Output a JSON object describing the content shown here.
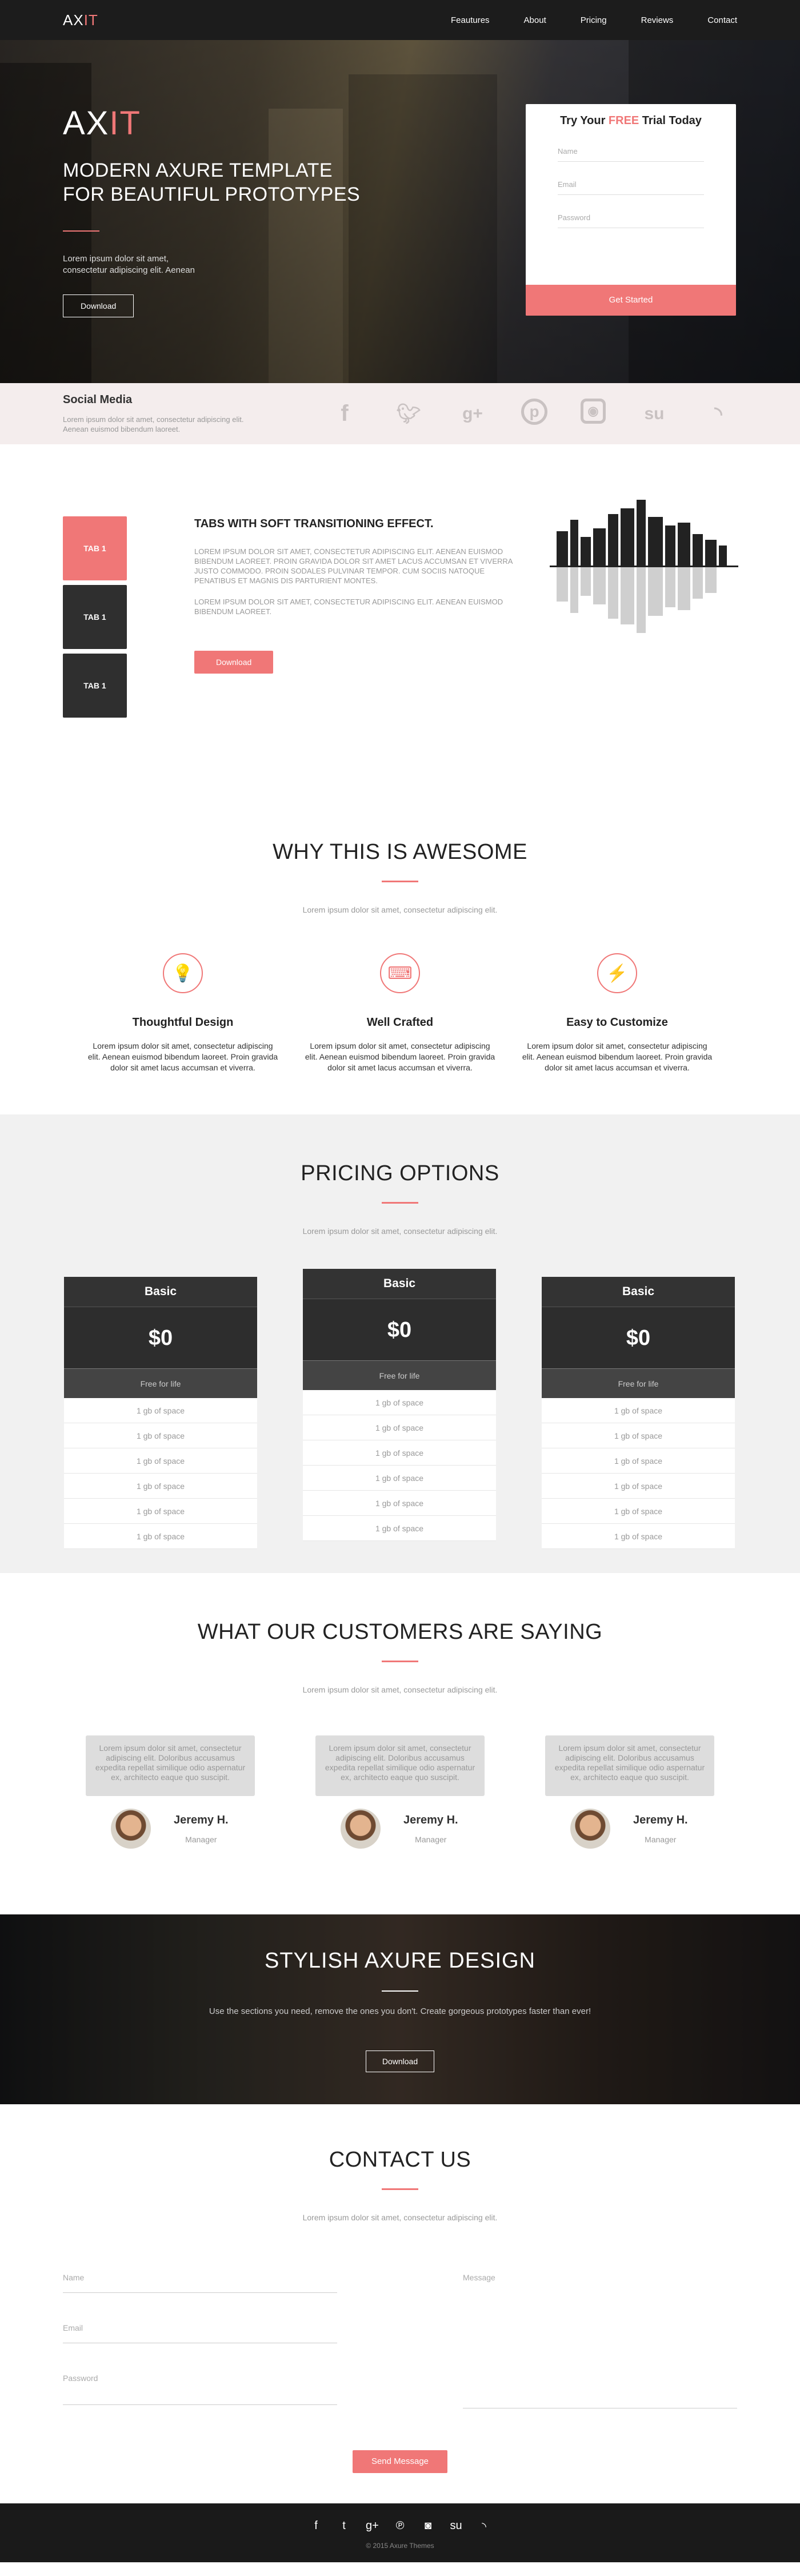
{
  "nav": {
    "logo_a": "AX",
    "logo_b": "IT",
    "links": [
      "Feautures",
      "About",
      "Pricing",
      "Reviews",
      "Contact"
    ]
  },
  "hero": {
    "logo_a": "AX",
    "logo_b": "IT",
    "title_line1": "MODERN AXURE TEMPLATE",
    "title_line2": "FOR BEAUTIFUL PROTOTYPES",
    "text_line1": "Lorem ipsum dolor sit amet,",
    "text_line2": "consectetur adipiscing elit. Aenean",
    "button": "Download"
  },
  "trial": {
    "title_a": "Try Your ",
    "title_free": "FREE",
    "title_b": " Trial Today",
    "name_placeholder": "Name",
    "email_placeholder": "Email",
    "password_placeholder": "Password",
    "button": "Get Started"
  },
  "social": {
    "title": "Social Media",
    "text": "Lorem ipsum dolor sit amet, consectetur adipiscing elit. Aenean euismod bibendum laoreet.",
    "icons": [
      "f",
      "t",
      "g+",
      "p",
      "ig",
      "su",
      "rss"
    ]
  },
  "tabs": {
    "labels": [
      "TAB 1",
      "TAB 1",
      "TAB 1"
    ],
    "heading": "TABS WITH SOFT TRANSITIONING EFFECT.",
    "para1": "LOREM IPSUM DOLOR SIT AMET, CONSECTETUR ADIPISCING ELIT. AENEAN EUISMOD BIBENDUM LAOREET. PROIN GRAVIDA DOLOR SIT AMET LACUS ACCUMSAN ET VIVERRA JUSTO COMMODO. PROIN SODALES PULVINAR TEMPOR. CUM SOCIIS NATOQUE PENATIBUS ET MAGNIS DIS PARTURIENT MONTES.",
    "para2": "LOREM IPSUM DOLOR SIT AMET, CONSECTETUR ADIPISCING ELIT. AENEAN EUISMOD BIBENDUM LAOREET.",
    "button": "Download"
  },
  "why": {
    "title": "WHY THIS IS AWESOME",
    "subtitle": "Lorem ipsum dolor sit amet, consectetur adipiscing elit.",
    "features": [
      {
        "icon": "lightbulb-icon",
        "glyph": "💡",
        "title": "Thoughtful Design",
        "text": "Lorem ipsum dolor sit amet, consectetur adipiscing elit. Aenean euismod bibendum laoreet. Proin gravida  dolor sit amet lacus accumsan et viverra."
      },
      {
        "icon": "keyboard-icon",
        "glyph": "⌨",
        "title": "Well Crafted",
        "text": "Lorem ipsum dolor sit amet, consectetur adipiscing elit. Aenean euismod bibendum laoreet. Proin gravida  dolor sit amet lacus accumsan et viverra."
      },
      {
        "icon": "bolt-icon",
        "glyph": "⚡",
        "title": "Easy to Customize",
        "text": "Lorem ipsum dolor sit amet, consectetur adipiscing elit. Aenean euismod bibendum laoreet. Proin gravida  dolor sit amet lacus accumsan et viverra."
      }
    ]
  },
  "pricing": {
    "title": "PRICING OPTIONS",
    "subtitle": "Lorem ipsum dolor sit amet, consectetur adipiscing elit.",
    "plans": [
      {
        "name": "Basic",
        "price": "$0",
        "note": "Free for life",
        "features": [
          "1 gb of space",
          "1 gb of space",
          "1 gb of space",
          "1 gb of space",
          "1 gb of space",
          "1 gb of space"
        ]
      },
      {
        "name": "Basic",
        "price": "$0",
        "note": "Free for life",
        "features": [
          "1 gb of space",
          "1 gb of space",
          "1 gb of space",
          "1 gb of space",
          "1 gb of space",
          "1 gb of space"
        ]
      },
      {
        "name": "Basic",
        "price": "$0",
        "note": "Free for life",
        "features": [
          "1 gb of space",
          "1 gb of space",
          "1 gb of space",
          "1 gb of space",
          "1 gb of space",
          "1 gb of space"
        ]
      }
    ]
  },
  "testimonials": {
    "title": "WHAT OUR CUSTOMERS ARE SAYING",
    "subtitle": "Lorem ipsum dolor sit amet, consectetur adipiscing elit.",
    "items": [
      {
        "quote": "Lorem ipsum dolor sit amet, consectetur adipiscing elit. Doloribus accusamus expedita repellat similique odio aspernatur ex, architecto eaque quo suscipit.",
        "name": "Jeremy H.",
        "role": "Manager"
      },
      {
        "quote": "Lorem ipsum dolor sit amet, consectetur adipiscing elit. Doloribus accusamus expedita repellat similique odio aspernatur ex, architecto eaque quo suscipit.",
        "name": "Jeremy H.",
        "role": "Manager"
      },
      {
        "quote": "Lorem ipsum dolor sit amet, consectetur adipiscing elit. Doloribus accusamus expedita repellat similique odio aspernatur ex, architecto eaque quo suscipit.",
        "name": "Jeremy H.",
        "role": "Manager"
      }
    ]
  },
  "banner": {
    "title": "STYLISH AXURE DESIGN",
    "text": "Use the sections you need, remove the ones you don't. Create gorgeous prototypes faster than ever!",
    "button": "Download"
  },
  "contact": {
    "title": "CONTACT US",
    "subtitle": "Lorem ipsum dolor sit amet, consectetur adipiscing elit.",
    "name_placeholder": "Name",
    "email_placeholder": "Email",
    "password_placeholder": "Password",
    "message_placeholder": "Message",
    "button": "Send Message"
  },
  "footer": {
    "icons": [
      "f",
      "t",
      "g+",
      "p",
      "ig",
      "su",
      "rss"
    ],
    "copyright": "© 2015 Axure Themes"
  }
}
